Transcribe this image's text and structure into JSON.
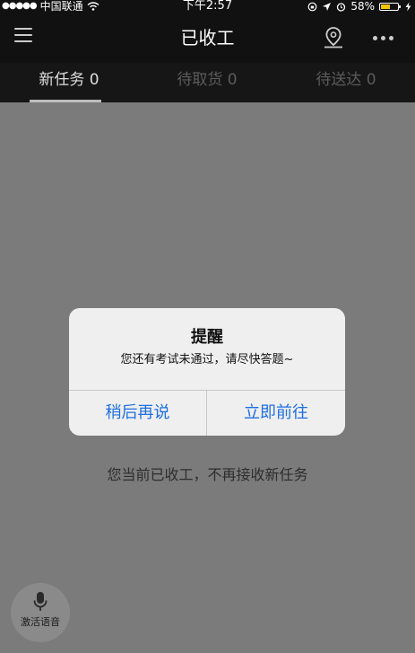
{
  "status_bar": {
    "signal": "●●●●●",
    "carrier": "中国联通",
    "time": "下午2:57",
    "battery_percent": "58%",
    "battery_level": 0.58,
    "battery_color": "#f5c400"
  },
  "header": {
    "title": "已收工",
    "menu_icon": "hamburger-menu-icon",
    "location_icon": "location-pin-icon",
    "more_icon": "more-dots-icon"
  },
  "tabs": [
    {
      "label": "新任务 0",
      "active": true
    },
    {
      "label": "待取货 0",
      "active": false
    },
    {
      "label": "待送达 0",
      "active": false
    }
  ],
  "main": {
    "empty_message": "您当前已收工，不再接收新任务"
  },
  "alert": {
    "title": "提醒",
    "message": "您还有考试未通过，请尽快答题~",
    "cancel_label": "稍后再说",
    "confirm_label": "立即前往",
    "button_color": "#1f6fe0"
  },
  "voice": {
    "label": "激活语音",
    "icon": "microphone-icon"
  }
}
